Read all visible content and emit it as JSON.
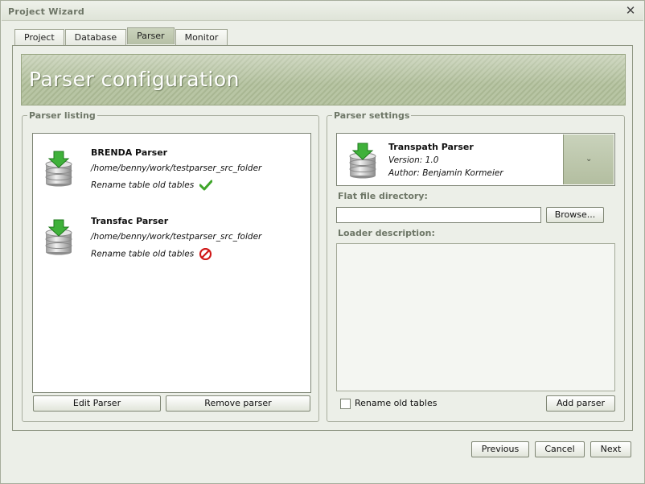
{
  "window": {
    "title": "Project Wizard",
    "close_glyph": "✕"
  },
  "tabs": [
    {
      "label": "Project",
      "active": false
    },
    {
      "label": "Database",
      "active": false
    },
    {
      "label": "Parser",
      "active": true
    },
    {
      "label": "Monitor",
      "active": false
    }
  ],
  "banner": {
    "title": "Parser configuration"
  },
  "parser_listing": {
    "label": "Parser listing",
    "items": [
      {
        "name": "BRENDA Parser",
        "path": "/home/benny/work/testparser_src_folder",
        "option": "Rename table old tables",
        "status": "ok",
        "status_icon": "check-icon"
      },
      {
        "name": "Transfac Parser",
        "path": "/home/benny/work/testparser_src_folder",
        "option": "Rename table old tables",
        "status": "disabled",
        "status_icon": "forbidden-icon"
      }
    ],
    "edit_button": "Edit Parser",
    "remove_button": "Remove parser"
  },
  "parser_settings": {
    "label": "Parser settings",
    "selected": {
      "name": "Transpath Parser",
      "version": "Version: 1.0",
      "author": "Author: Benjamin Kormeier"
    },
    "dropdown_glyph": "⌄",
    "flat_file_label": "Flat file directory:",
    "flat_file_value": "",
    "browse_button": "Browse...",
    "loader_label": "Loader description:",
    "loader_value": "",
    "rename_checkbox_label": "Rename old tables",
    "rename_checked": false,
    "add_button": "Add parser"
  },
  "footer": {
    "previous": "Previous",
    "cancel": "Cancel",
    "next": "Next"
  },
  "colors": {
    "accent": "#b6c0a6",
    "banner_text": "#ffffff",
    "ok": "#3fa52a",
    "forbidden": "#d01818"
  }
}
